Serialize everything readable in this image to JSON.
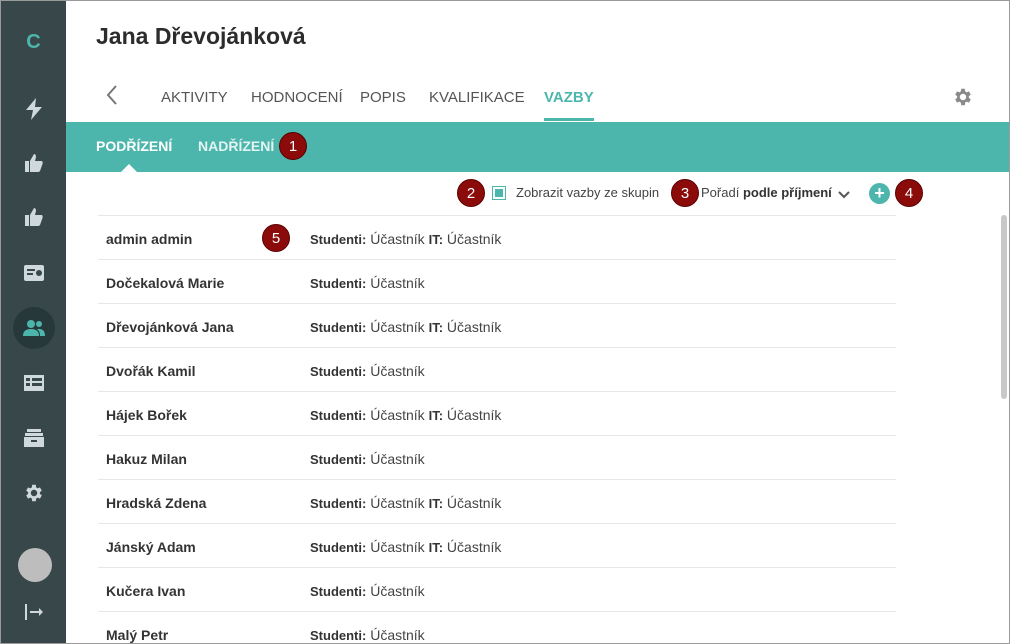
{
  "sidebar": {
    "logo": "C",
    "items": [
      {
        "icon": "lightning-icon"
      },
      {
        "icon": "thumbs-up-icon"
      },
      {
        "icon": "thumbs-up-icon"
      },
      {
        "icon": "id-card-icon"
      },
      {
        "icon": "users-icon",
        "active": true
      },
      {
        "icon": "table-icon"
      },
      {
        "icon": "archive-icon"
      },
      {
        "icon": "gear-icon"
      }
    ]
  },
  "header": {
    "title": "Jana Dřevojánková",
    "tabs": [
      "AKTIVITY",
      "HODNOCENÍ",
      "POPIS",
      "KVALIFIKACE",
      "VAZBY"
    ],
    "active_tab": "VAZBY"
  },
  "subtabs": {
    "items": [
      "PODŘÍZENÍ",
      "NADŘÍZENÍ"
    ],
    "active": "PODŘÍZENÍ"
  },
  "badges": [
    "1",
    "2",
    "3",
    "4",
    "5"
  ],
  "toolbar": {
    "show_groups_label": "Zobrazit vazby ze skupin",
    "show_groups_checked": true,
    "sort_prefix": "Pořadí",
    "sort_value": "podle příjmení",
    "add_label": "+"
  },
  "rows": [
    {
      "name": "admin admin",
      "roles": [
        {
          "group": "Studenti:",
          "role": "Účastník"
        },
        {
          "group": "IT:",
          "role": "Účastník"
        }
      ]
    },
    {
      "name": "Dočekalová Marie",
      "roles": [
        {
          "group": "Studenti:",
          "role": "Účastník"
        }
      ]
    },
    {
      "name": "Dřevojánková Jana",
      "roles": [
        {
          "group": "Studenti:",
          "role": "Účastník"
        },
        {
          "group": "IT:",
          "role": "Účastník"
        }
      ]
    },
    {
      "name": "Dvořák Kamil",
      "roles": [
        {
          "group": "Studenti:",
          "role": "Účastník"
        }
      ]
    },
    {
      "name": "Hájek Bořek",
      "roles": [
        {
          "group": "Studenti:",
          "role": "Účastník"
        },
        {
          "group": "IT:",
          "role": "Účastník"
        }
      ]
    },
    {
      "name": "Hakuz Milan",
      "roles": [
        {
          "group": "Studenti:",
          "role": "Účastník"
        }
      ]
    },
    {
      "name": "Hradská Zdena",
      "roles": [
        {
          "group": "Studenti:",
          "role": "Účastník"
        },
        {
          "group": "IT:",
          "role": "Účastník"
        }
      ]
    },
    {
      "name": "Jánský Adam",
      "roles": [
        {
          "group": "Studenti:",
          "role": "Účastník"
        },
        {
          "group": "IT:",
          "role": "Účastník"
        }
      ]
    },
    {
      "name": "Kučera Ivan",
      "roles": [
        {
          "group": "Studenti:",
          "role": "Účastník"
        }
      ]
    },
    {
      "name": "Malý Petr",
      "roles": [
        {
          "group": "Studenti:",
          "role": "Účastník"
        }
      ]
    }
  ],
  "colors": {
    "accent": "#4db6ac",
    "sidebar": "#37474a",
    "badge": "#8b0a0a"
  }
}
